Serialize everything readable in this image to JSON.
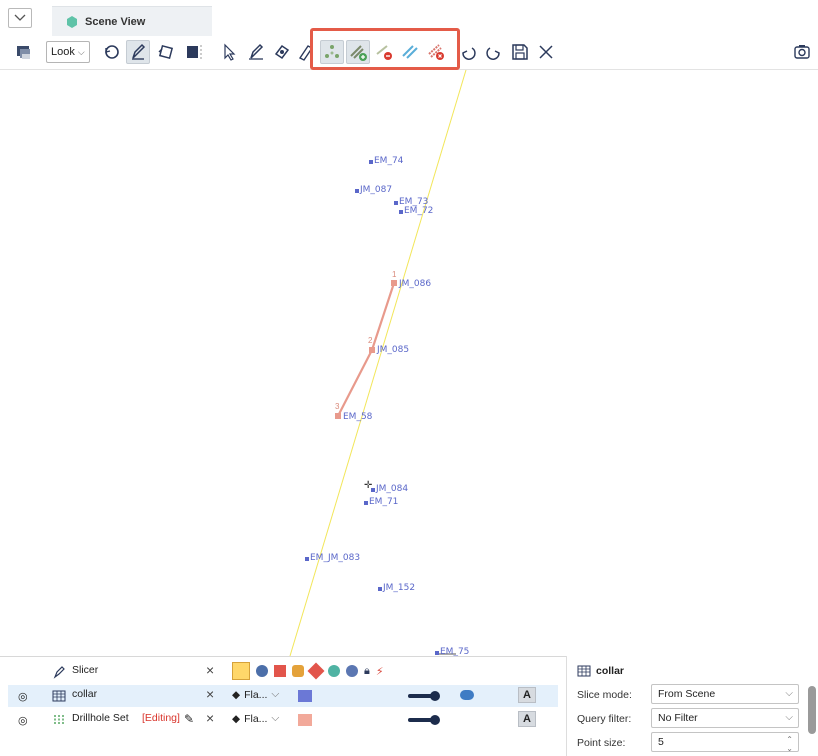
{
  "tab": {
    "title": "Scene View",
    "icon": "scene-hexagon-icon",
    "accent": "#5fc3a8"
  },
  "toolbar": {
    "look_label": "Look",
    "tools": [
      "remove-layers-icon",
      "rotate-icon",
      "slicer-pen-icon",
      "reset-slicer-icon",
      "box-select-icon",
      "pointer-icon",
      "draw-line-icon",
      "edit-line-icon",
      "measure-icon",
      "select-points-icon",
      "add-points-icon",
      "remove-point-icon",
      "tidy-icon",
      "delete-points-icon",
      "undo-icon",
      "redo-icon",
      "save-icon",
      "close-icon",
      "screenshot-icon"
    ],
    "highlight_color": "#e45b48"
  },
  "scene": {
    "points": [
      {
        "label": "EM_74"
      },
      {
        "label": "JM_087"
      },
      {
        "label": "EM_73"
      },
      {
        "label": "EM_72"
      },
      {
        "label": "JM_086"
      },
      {
        "label": "JM_085"
      },
      {
        "label": "EM_58"
      },
      {
        "label": "JM_084"
      },
      {
        "label": "EM_71"
      },
      {
        "label": "EM_JM_083"
      },
      {
        "label": "JM_152"
      },
      {
        "label": "EM_75"
      }
    ],
    "path_indices": [
      "1",
      "2",
      "3"
    ],
    "point_color": "#5a67c9",
    "path_color": "#e89a8c",
    "slice_line_color": "#f2e65a"
  },
  "objects": {
    "rows": [
      {
        "name": "Slicer",
        "icon": "slicer-pen-icon"
      },
      {
        "name": "collar",
        "icon": "table-grid-icon",
        "fill": "Fla...",
        "color": "#6b78d6"
      },
      {
        "name": "Drillhole Set",
        "editing": "[Editing]",
        "icon": "drillhole-icon",
        "fill": "Fla...",
        "color": "#f2a99a"
      }
    ],
    "shape_icons": [
      "cube-yellow-icon",
      "sphere-blue-icon",
      "cube-red-icon",
      "dodecahedron-icon",
      "gem-red-icon",
      "hex-teal-icon",
      "disc-icon",
      "lock-icon",
      "wand-icon"
    ]
  },
  "properties": {
    "title": "collar",
    "slice_mode_label": "Slice mode:",
    "slice_mode_value": "From Scene",
    "query_filter_label": "Query filter:",
    "query_filter_value": "No Filter",
    "point_size_label": "Point size:",
    "point_size_value": "5"
  }
}
